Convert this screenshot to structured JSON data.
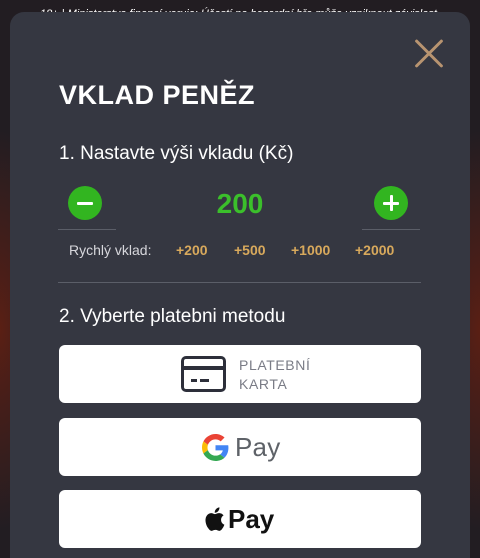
{
  "disclaimer": "18+ | Ministerstvo financí varuje: Účastí na hazardní hře může vzniknout závislost.",
  "modal": {
    "title": "VKLAD PENĚZ",
    "step1_label": "1. Nastavte výši vkladu (Kč)",
    "amount": "200",
    "quick_deposit_label": "Rychlý vklad:",
    "quick_options": [
      "+200",
      "+500",
      "+1000",
      "+2000"
    ],
    "step2_label": "2. Vyberte platebni metodu",
    "payment_methods": [
      {
        "name": "card",
        "label_line1": "PLATEBNÍ",
        "label_line2": "KARTA",
        "icon": "credit-card-icon"
      },
      {
        "name": "google-pay",
        "label": "Pay",
        "icon": "google-g-icon"
      },
      {
        "name": "apple-pay",
        "label": "Pay",
        "icon": "apple-icon"
      }
    ]
  },
  "colors": {
    "modal_bg": "#353741",
    "accent_green": "#32b520",
    "amount_green": "#3bbf2b",
    "quick_gold": "#d8a95c",
    "close_gold": "#b89470"
  }
}
